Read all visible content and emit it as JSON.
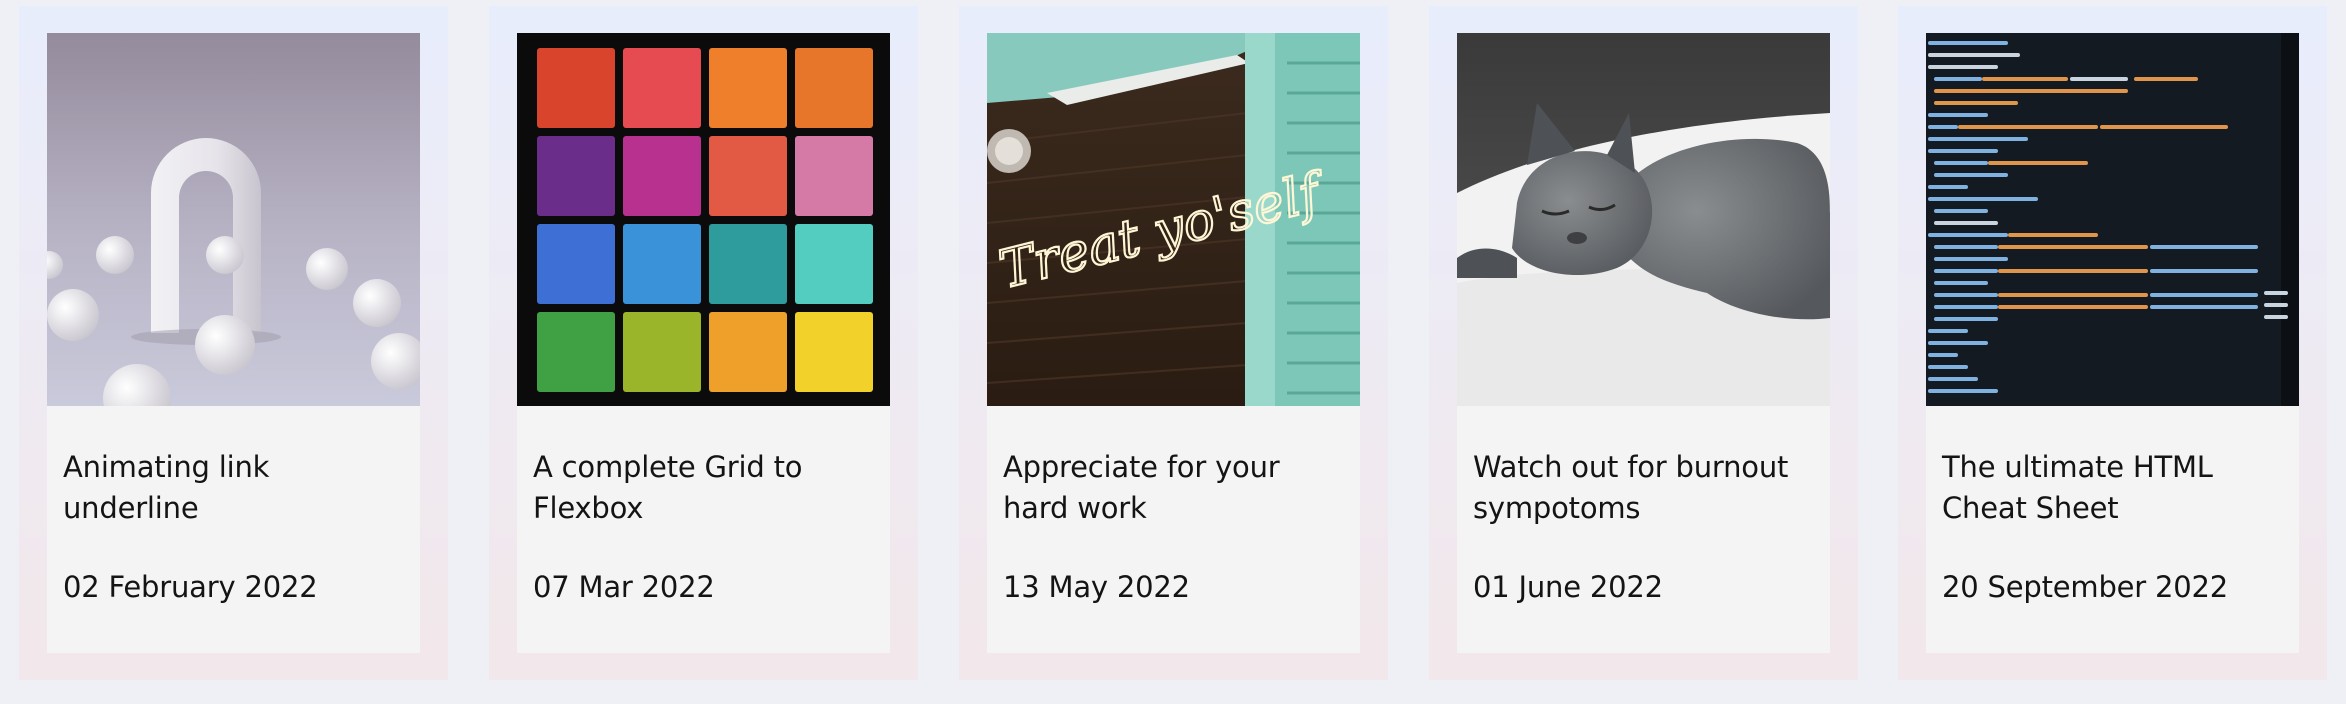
{
  "cards": [
    {
      "title": "Animating link underline",
      "date": "02 February 2022",
      "image": "3d-arch-and-spheres-image"
    },
    {
      "title": "A complete Grid to Flexbox",
      "date": "07 Mar 2022",
      "image": "eyeshadow-palette-image"
    },
    {
      "title": "Appreciate for your hard work",
      "date": "13 May 2022",
      "image": "neon-sign-treat-yoself-image"
    },
    {
      "title": "Watch out for burnout sympotoms",
      "date": "01 June 2022",
      "image": "sleeping-grey-cat-image"
    },
    {
      "title": "The ultimate HTML Cheat Sheet",
      "date": "20 September 2022",
      "image": "html-source-code-image"
    }
  ],
  "neon_text": "Treat yo'self"
}
